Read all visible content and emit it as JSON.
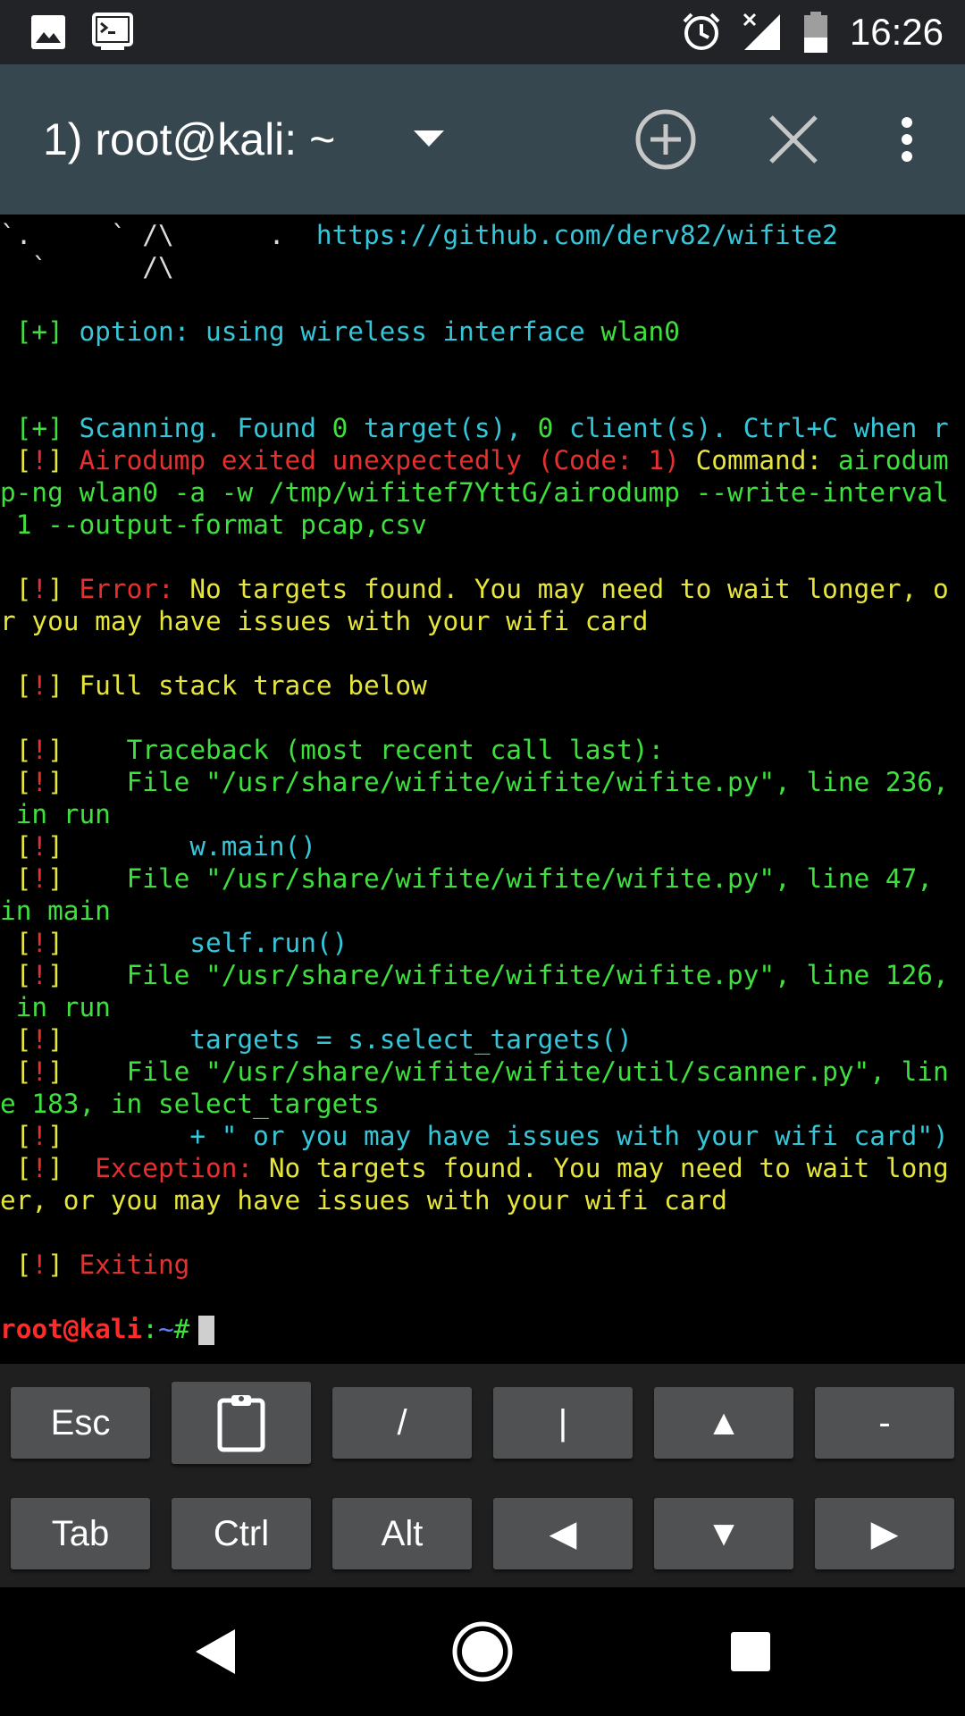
{
  "status_bar": {
    "time": "16:26",
    "left_icons": [
      "image-notification-icon",
      "terminal-notification-icon"
    ],
    "right_icons": [
      "alarm-icon",
      "signal-no-service-icon",
      "battery-icon"
    ]
  },
  "toolbar": {
    "session_title": "1) root@kali: ~",
    "icons": [
      "dropdown-arrow-icon",
      "add-session-icon",
      "close-session-icon",
      "overflow-menu-icon"
    ]
  },
  "terminal": {
    "lines": [
      [
        {
          "t": "`.     ` /\\      .  ",
          "c": "white"
        },
        {
          "t": "https://github.com/derv82/wifite2",
          "c": "cyan"
        }
      ],
      [
        {
          "t": "  `      /\\",
          "c": "white"
        }
      ],
      [
        {
          "t": "",
          "c": "white"
        }
      ],
      [
        {
          "t": " [+] ",
          "c": "green"
        },
        {
          "t": "option: using wireless interface ",
          "c": "cyan"
        },
        {
          "t": "wlan0",
          "c": "green"
        }
      ],
      [
        {
          "t": "",
          "c": "white"
        }
      ],
      [
        {
          "t": "",
          "c": "white"
        }
      ],
      [
        {
          "t": " [+] ",
          "c": "green"
        },
        {
          "t": "Scanning. Found ",
          "c": "cyan"
        },
        {
          "t": "0",
          "c": "green"
        },
        {
          "t": " target(s), ",
          "c": "cyan"
        },
        {
          "t": "0",
          "c": "green"
        },
        {
          "t": " client(s). Ctrl+C when r",
          "c": "cyan"
        }
      ],
      [
        {
          "t": " [",
          "c": "yellow"
        },
        {
          "t": "!",
          "c": "red"
        },
        {
          "t": "] ",
          "c": "yellow"
        },
        {
          "t": "Airodump exited unexpectedly (Code: 1) ",
          "c": "red"
        },
        {
          "t": "Command: ",
          "c": "yellow"
        },
        {
          "t": "airodum",
          "c": "green"
        }
      ],
      [
        {
          "t": "p-ng wlan0 -a -w /tmp/wifitef7YttG/airodump --write-interval",
          "c": "green"
        }
      ],
      [
        {
          "t": " 1 --output-format pcap,csv",
          "c": "green"
        }
      ],
      [
        {
          "t": "",
          "c": "white"
        }
      ],
      [
        {
          "t": " [",
          "c": "yellow"
        },
        {
          "t": "!",
          "c": "red"
        },
        {
          "t": "] ",
          "c": "yellow"
        },
        {
          "t": "Error: ",
          "c": "red"
        },
        {
          "t": "No targets found. You may need to wait longer, o",
          "c": "yellow"
        }
      ],
      [
        {
          "t": "r you may have issues with your wifi card",
          "c": "yellow"
        }
      ],
      [
        {
          "t": "",
          "c": "white"
        }
      ],
      [
        {
          "t": " [",
          "c": "yellow"
        },
        {
          "t": "!",
          "c": "red"
        },
        {
          "t": "] ",
          "c": "yellow"
        },
        {
          "t": "Full stack trace below",
          "c": "yellow"
        }
      ],
      [
        {
          "t": "",
          "c": "white"
        }
      ],
      [
        {
          "t": " [",
          "c": "yellow"
        },
        {
          "t": "!",
          "c": "red"
        },
        {
          "t": "]    ",
          "c": "yellow"
        },
        {
          "t": "Traceback (most recent call last):",
          "c": "green"
        }
      ],
      [
        {
          "t": " [",
          "c": "yellow"
        },
        {
          "t": "!",
          "c": "red"
        },
        {
          "t": "]    ",
          "c": "yellow"
        },
        {
          "t": "File \"/usr/share/wifite/wifite/wifite.py\", line 236,",
          "c": "green"
        }
      ],
      [
        {
          "t": " in run",
          "c": "green"
        }
      ],
      [
        {
          "t": " [",
          "c": "yellow"
        },
        {
          "t": "!",
          "c": "red"
        },
        {
          "t": "]        ",
          "c": "yellow"
        },
        {
          "t": "w.main()",
          "c": "cyan"
        }
      ],
      [
        {
          "t": " [",
          "c": "yellow"
        },
        {
          "t": "!",
          "c": "red"
        },
        {
          "t": "]    ",
          "c": "yellow"
        },
        {
          "t": "File \"/usr/share/wifite/wifite/wifite.py\", line 47,",
          "c": "green"
        }
      ],
      [
        {
          "t": "in main",
          "c": "green"
        }
      ],
      [
        {
          "t": " [",
          "c": "yellow"
        },
        {
          "t": "!",
          "c": "red"
        },
        {
          "t": "]        ",
          "c": "yellow"
        },
        {
          "t": "self.run()",
          "c": "cyan"
        }
      ],
      [
        {
          "t": " [",
          "c": "yellow"
        },
        {
          "t": "!",
          "c": "red"
        },
        {
          "t": "]    ",
          "c": "yellow"
        },
        {
          "t": "File \"/usr/share/wifite/wifite/wifite.py\", line 126,",
          "c": "green"
        }
      ],
      [
        {
          "t": " in run",
          "c": "green"
        }
      ],
      [
        {
          "t": " [",
          "c": "yellow"
        },
        {
          "t": "!",
          "c": "red"
        },
        {
          "t": "]        ",
          "c": "yellow"
        },
        {
          "t": "targets = s.select_targets()",
          "c": "cyan"
        }
      ],
      [
        {
          "t": " [",
          "c": "yellow"
        },
        {
          "t": "!",
          "c": "red"
        },
        {
          "t": "]    ",
          "c": "yellow"
        },
        {
          "t": "File \"/usr/share/wifite/wifite/util/scanner.py\", lin",
          "c": "green"
        }
      ],
      [
        {
          "t": "e 183, in select_targets",
          "c": "green"
        }
      ],
      [
        {
          "t": " [",
          "c": "yellow"
        },
        {
          "t": "!",
          "c": "red"
        },
        {
          "t": "]        ",
          "c": "yellow"
        },
        {
          "t": "+ \" or you may have issues with your wifi card\")",
          "c": "cyan"
        }
      ],
      [
        {
          "t": " [",
          "c": "yellow"
        },
        {
          "t": "!",
          "c": "red"
        },
        {
          "t": "]  ",
          "c": "yellow"
        },
        {
          "t": "Exception: ",
          "c": "red"
        },
        {
          "t": "No targets found. You may need to wait long",
          "c": "yellow"
        }
      ],
      [
        {
          "t": "er, or you may have issues with your wifi card",
          "c": "yellow"
        }
      ],
      [
        {
          "t": "",
          "c": "white"
        }
      ],
      [
        {
          "t": " [",
          "c": "yellow"
        },
        {
          "t": "!",
          "c": "red"
        },
        {
          "t": "] ",
          "c": "yellow"
        },
        {
          "t": "Exiting",
          "c": "red"
        }
      ],
      [
        {
          "t": "",
          "c": "white"
        }
      ]
    ],
    "prompt": {
      "user_host": "root@kali",
      "colon": ":",
      "path": "~",
      "symbol": "#"
    }
  },
  "extra_keys": {
    "row1": [
      "Esc",
      "",
      "/",
      "|",
      "▲",
      "-"
    ],
    "row2": [
      "Tab",
      "Ctrl",
      "Alt",
      "◀",
      "▼",
      "▶"
    ]
  },
  "nav_bar": {
    "icons": [
      "back-icon",
      "home-icon",
      "recents-icon"
    ]
  },
  "colors": {
    "green": "#3ee03e",
    "cyan": "#35c7d9",
    "yellow": "#e5e53c",
    "red": "#e53030",
    "white": "#dcdcdc",
    "toolbar": "#37474f",
    "status_bar": "#222326"
  }
}
